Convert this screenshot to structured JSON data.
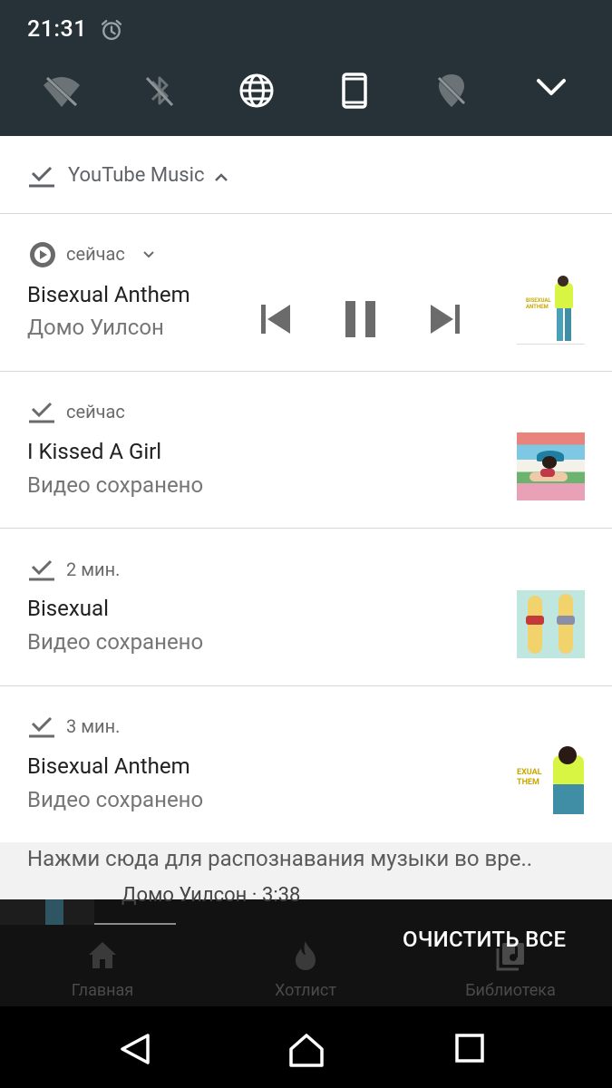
{
  "status": {
    "time": "21:31"
  },
  "quick_settings": {
    "tiles": [
      "wifi-off-icon",
      "bluetooth-off-icon",
      "globe-icon",
      "phone-portrait-icon",
      "location-off-icon"
    ],
    "expand_icon": "chevron-down-icon"
  },
  "group": {
    "app_name": "YouTube Music"
  },
  "media": {
    "time": "сейчас",
    "title": "Bisexual Anthem",
    "artist": "Домо Уилсон",
    "thumb_text": "BISEXUAL ANTHEM"
  },
  "notifications": [
    {
      "time": "сейчас",
      "title": "I Kissed A Girl",
      "subtitle": "Видео сохранено"
    },
    {
      "time": "2 мин.",
      "title": "Bisexual",
      "subtitle": "Видео сохранено"
    },
    {
      "time": "3 мин.",
      "title": "Bisexual Anthem",
      "subtitle": "Видео сохранено",
      "thumb_text": "EXUAL THEM"
    }
  ],
  "background_app": {
    "hint": "Нажми сюда для распознавания музыки во вре..",
    "mini_player_text": "Домо Уилсон · 3:38",
    "nav": [
      {
        "label": "Главная",
        "icon": "home-icon"
      },
      {
        "label": "Хотлист",
        "icon": "flame-icon"
      },
      {
        "label": "Библиотека",
        "icon": "library-icon"
      }
    ]
  },
  "clear_all": "ОЧИСТИТЬ ВСЕ",
  "colors": {
    "quick_settings_bg": "#263238",
    "accent_yellow": "#d7f542"
  }
}
